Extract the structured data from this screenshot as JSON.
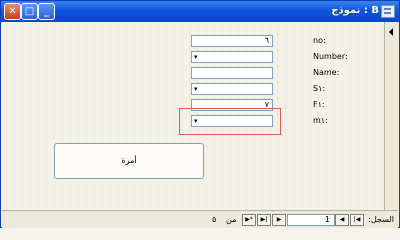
{
  "window": {
    "title": "B : نموذج"
  },
  "labels": {
    "no": "no:",
    "number": "Number:",
    "name": "Name:",
    "s1": "S١:",
    "f1": "F١:",
    "m1": "m١:"
  },
  "fields": {
    "no_value": "٦",
    "f1_value": "٧"
  },
  "button": {
    "label": "أمرة"
  },
  "nav": {
    "label": "السجل:",
    "current": "1",
    "of_text": "من",
    "total": "٥"
  },
  "icons": {
    "minimize": "minimize-icon",
    "maximize": "maximize-icon",
    "close": "close-icon"
  }
}
